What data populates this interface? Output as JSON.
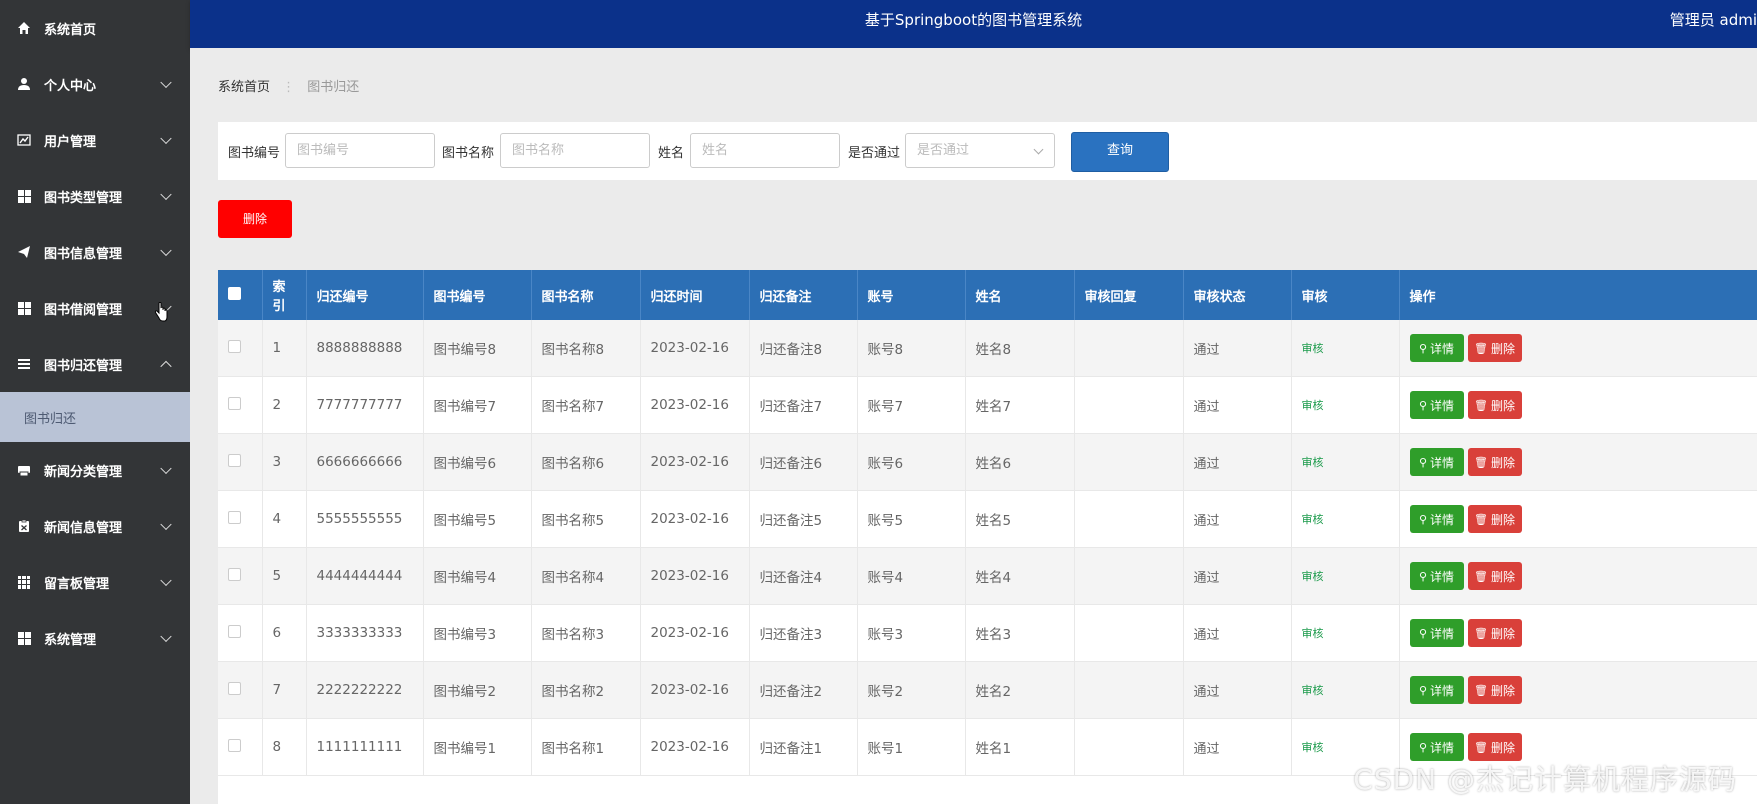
{
  "sidebar": {
    "items": [
      {
        "label": "系统首页",
        "icon": "home-icon",
        "expandable": false
      },
      {
        "label": "个人中心",
        "icon": "user-icon",
        "expandable": true
      },
      {
        "label": "用户管理",
        "icon": "chart-icon",
        "expandable": true
      },
      {
        "label": "图书类型管理",
        "icon": "grid-icon",
        "expandable": true
      },
      {
        "label": "图书信息管理",
        "icon": "send-icon",
        "expandable": true
      },
      {
        "label": "图书借阅管理",
        "icon": "grid-icon",
        "expandable": true
      },
      {
        "label": "图书归还管理",
        "icon": "list-icon",
        "expandable": true,
        "expanded": true
      },
      {
        "label": "新闻分类管理",
        "icon": "printer-icon",
        "expandable": true
      },
      {
        "label": "新闻信息管理",
        "icon": "clipboard-icon",
        "expandable": true
      },
      {
        "label": "留言板管理",
        "icon": "grid9-icon",
        "expandable": true
      },
      {
        "label": "系统管理",
        "icon": "grid-icon",
        "expandable": true
      }
    ],
    "sub_item": "图书归还"
  },
  "topbar": {
    "title": "基于Springboot的图书管理系统",
    "user": "管理员 admi"
  },
  "breadcrumb": {
    "home": "系统首页",
    "sep": "⋮",
    "current": "图书归还"
  },
  "search": {
    "label_book_no": "图书编号",
    "placeholder_book_no": "图书编号",
    "label_book_name": "图书名称",
    "placeholder_book_name": "图书名称",
    "label_name": "姓名",
    "placeholder_name": "姓名",
    "label_passed": "是否通过",
    "placeholder_passed": "是否通过",
    "query_label": "查询"
  },
  "actions": {
    "delete_label": "删除"
  },
  "table": {
    "headers": [
      "索引",
      "归还编号",
      "图书编号",
      "图书名称",
      "归还时间",
      "归还备注",
      "账号",
      "姓名",
      "审核回复",
      "审核状态",
      "审核",
      "操作"
    ],
    "rows": [
      {
        "index": "1",
        "return_no": "8888888888",
        "book_no": "图书编号8",
        "book_name": "图书名称8",
        "return_time": "2023-02-16",
        "remark": "归还备注8",
        "account": "账号8",
        "name": "姓名8",
        "reply": "",
        "status": "通过",
        "audit": "审核"
      },
      {
        "index": "2",
        "return_no": "7777777777",
        "book_no": "图书编号7",
        "book_name": "图书名称7",
        "return_time": "2023-02-16",
        "remark": "归还备注7",
        "account": "账号7",
        "name": "姓名7",
        "reply": "",
        "status": "通过",
        "audit": "审核"
      },
      {
        "index": "3",
        "return_no": "6666666666",
        "book_no": "图书编号6",
        "book_name": "图书名称6",
        "return_time": "2023-02-16",
        "remark": "归还备注6",
        "account": "账号6",
        "name": "姓名6",
        "reply": "",
        "status": "通过",
        "audit": "审核"
      },
      {
        "index": "4",
        "return_no": "5555555555",
        "book_no": "图书编号5",
        "book_name": "图书名称5",
        "return_time": "2023-02-16",
        "remark": "归还备注5",
        "account": "账号5",
        "name": "姓名5",
        "reply": "",
        "status": "通过",
        "audit": "审核"
      },
      {
        "index": "5",
        "return_no": "4444444444",
        "book_no": "图书编号4",
        "book_name": "图书名称4",
        "return_time": "2023-02-16",
        "remark": "归还备注4",
        "account": "账号4",
        "name": "姓名4",
        "reply": "",
        "status": "通过",
        "audit": "审核"
      },
      {
        "index": "6",
        "return_no": "3333333333",
        "book_no": "图书编号3",
        "book_name": "图书名称3",
        "return_time": "2023-02-16",
        "remark": "归还备注3",
        "account": "账号3",
        "name": "姓名3",
        "reply": "",
        "status": "通过",
        "audit": "审核"
      },
      {
        "index": "7",
        "return_no": "2222222222",
        "book_no": "图书编号2",
        "book_name": "图书名称2",
        "return_time": "2023-02-16",
        "remark": "归还备注2",
        "account": "账号2",
        "name": "姓名2",
        "reply": "",
        "status": "通过",
        "audit": "审核"
      },
      {
        "index": "8",
        "return_no": "1111111111",
        "book_no": "图书编号1",
        "book_name": "图书名称1",
        "return_time": "2023-02-16",
        "remark": "归还备注1",
        "account": "账号1",
        "name": "姓名1",
        "reply": "",
        "status": "通过",
        "audit": "审核"
      }
    ],
    "detail_label": "详情",
    "remove_label": "删除"
  },
  "watermark": "CSDN @杰记计算机程序源码",
  "colors": {
    "sidebar": "#333537",
    "topbar": "#0b318a",
    "table_header": "#2c6fb5",
    "detail": "#2f9e2a",
    "remove": "#d9403a",
    "delete": "#ff0000"
  }
}
